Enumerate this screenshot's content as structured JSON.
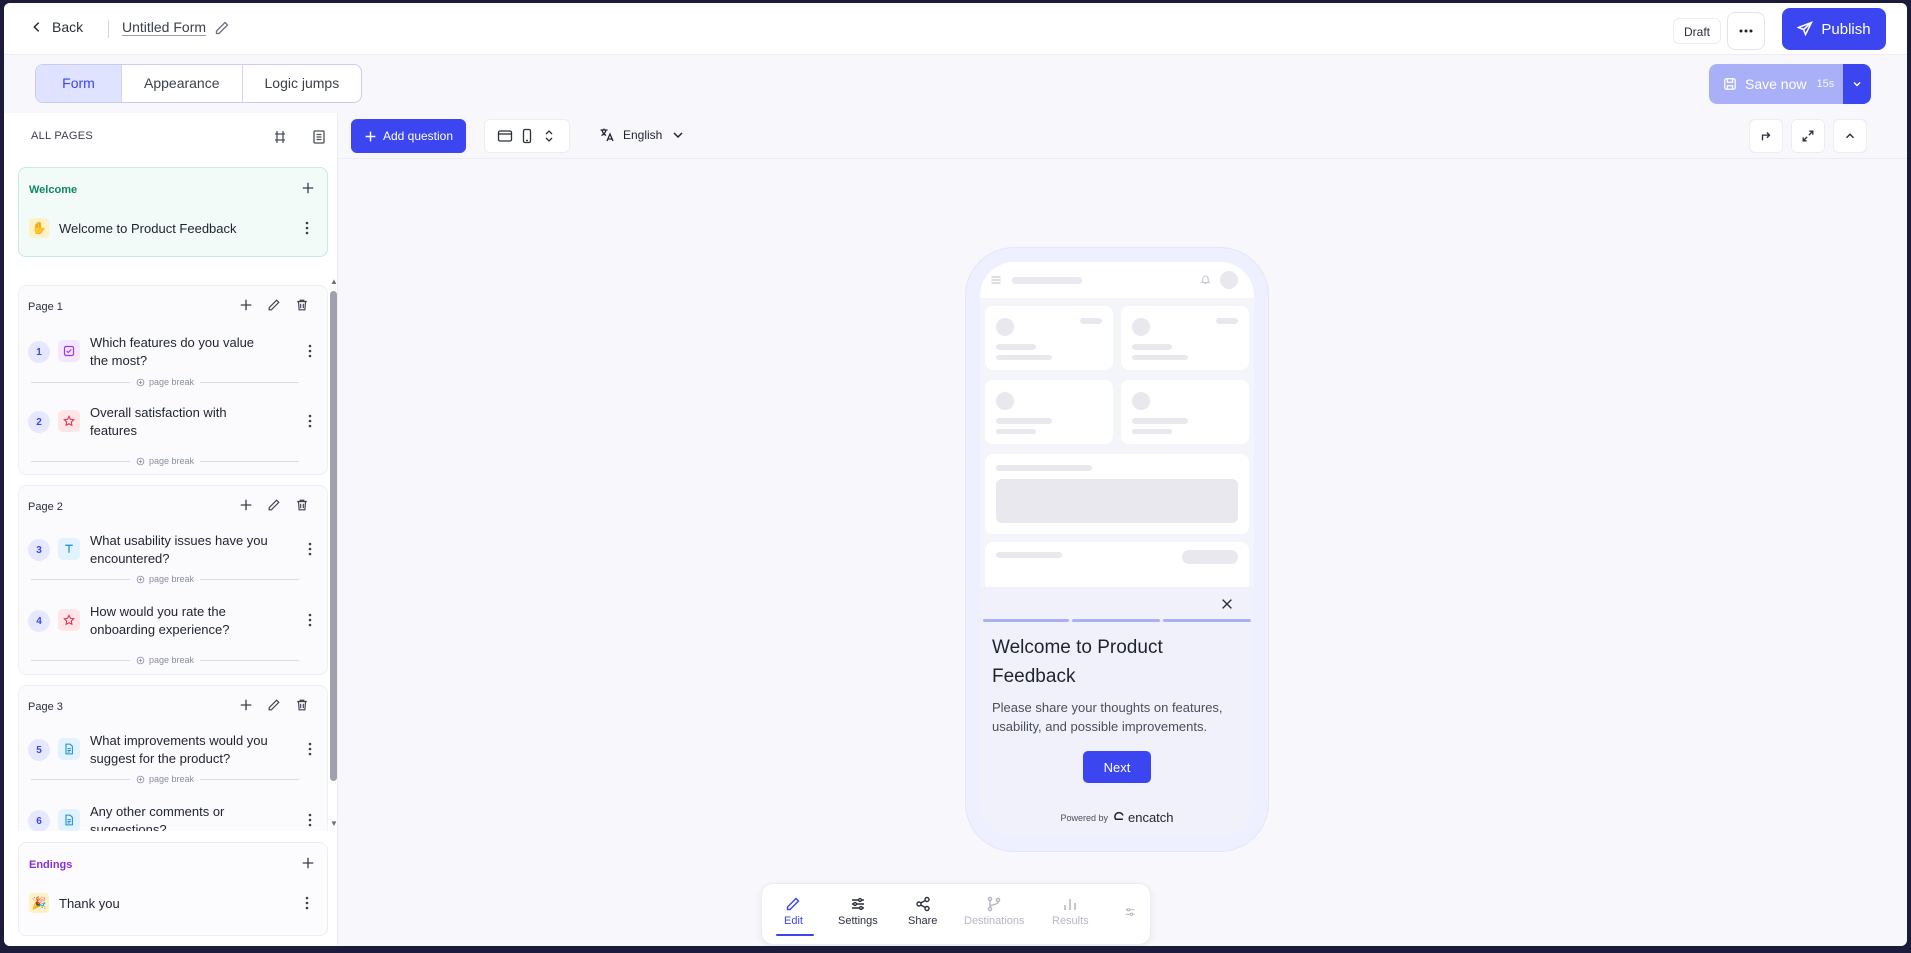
{
  "header": {
    "back_label": "Back",
    "form_title": "Untitled Form",
    "status": "Draft",
    "publish_label": "Publish"
  },
  "mode_tabs": [
    {
      "label": "Form",
      "active": true
    },
    {
      "label": "Appearance",
      "active": false
    },
    {
      "label": "Logic jumps",
      "active": false
    }
  ],
  "save": {
    "label": "Save now",
    "timer": "15s"
  },
  "sidebar": {
    "heading": "ALL PAGES",
    "welcome": {
      "title": "Welcome",
      "item": "Welcome to Product Feedback",
      "color": "#0f8a5f"
    },
    "page_break_label": "page break",
    "pages": [
      {
        "title": "Page 1",
        "questions": [
          {
            "num": "1",
            "text": "Which features do you value the most?",
            "type": "checkbox"
          },
          {
            "num": "2",
            "text": "Overall satisfaction with features",
            "type": "rating"
          }
        ]
      },
      {
        "title": "Page 2",
        "questions": [
          {
            "num": "3",
            "text": "What usability issues have you encountered?",
            "type": "text"
          },
          {
            "num": "4",
            "text": "How would you rate the onboarding experience?",
            "type": "rating"
          }
        ]
      },
      {
        "title": "Page 3",
        "questions": [
          {
            "num": "5",
            "text": "What improvements would you suggest for the product?",
            "type": "long-text"
          },
          {
            "num": "6",
            "text": "Any other comments or suggestions?",
            "type": "long-text"
          }
        ]
      }
    ],
    "endings": {
      "title": "Endings",
      "item": "Thank you",
      "color": "#8a2be2"
    }
  },
  "toolbar": {
    "add_question": "Add question",
    "language": "English"
  },
  "preview": {
    "title": "Welcome to Product Feedback",
    "description": "Please share your thoughts on features, usability, and possible improvements.",
    "next_label": "Next",
    "powered_by": "Powered by",
    "brand": "encatch"
  },
  "dock": [
    {
      "label": "Edit",
      "state": "active"
    },
    {
      "label": "Settings",
      "state": "normal"
    },
    {
      "label": "Share",
      "state": "normal"
    },
    {
      "label": "Destinations",
      "state": "disabled"
    },
    {
      "label": "Results",
      "state": "disabled"
    }
  ],
  "colors": {
    "accent": "#3b46f1",
    "accent_light": "#dfe3ff"
  }
}
